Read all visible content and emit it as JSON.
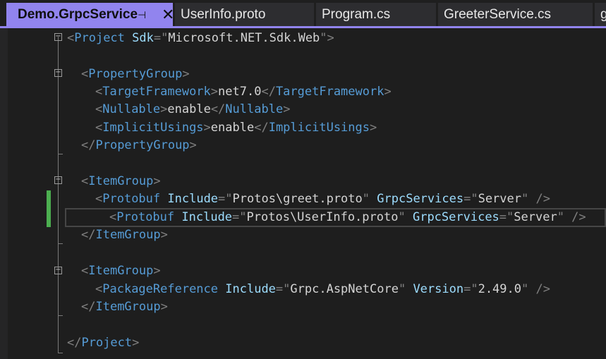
{
  "tabs": {
    "active": "Demo.GrpcService",
    "pin_glyph": "⊣",
    "close_glyph": "✕",
    "others": [
      "UserInfo.proto",
      "Program.cs",
      "GreeterService.cs",
      "g"
    ]
  },
  "code": {
    "line1": {
      "open": "<",
      "tag": "Project",
      "attr": "Sdk",
      "eq": "=\"",
      "val": "Microsoft.NET.Sdk.Web",
      "close": "\">"
    },
    "line3": {
      "open": "<",
      "tag": "PropertyGroup",
      "close": ">"
    },
    "line4": {
      "open": "<",
      "tag": "TargetFramework",
      "mid": ">",
      "text": "net7.0",
      "open2": "</",
      "tag2": "TargetFramework",
      "close": ">"
    },
    "line5": {
      "open": "<",
      "tag": "Nullable",
      "mid": ">",
      "text": "enable",
      "open2": "</",
      "tag2": "Nullable",
      "close": ">"
    },
    "line6": {
      "open": "<",
      "tag": "ImplicitUsings",
      "mid": ">",
      "text": "enable",
      "open2": "</",
      "tag2": "ImplicitUsings",
      "close": ">"
    },
    "line7": {
      "open": "</",
      "tag": "PropertyGroup",
      "close": ">"
    },
    "line9": {
      "open": "<",
      "tag": "ItemGroup",
      "close": ">"
    },
    "line10": {
      "open": "<",
      "tag": "Protobuf",
      "attr": "Include",
      "eq": "=\"",
      "val": "Protos\\greet.proto",
      "q": "\"",
      "attr2": "GrpcServices",
      "eq2": "=\"",
      "val2": "Server",
      "close": "\" />"
    },
    "line11": {
      "open": "<",
      "tag": "Protobuf",
      "attr": "Include",
      "eq": "=\"",
      "val": "Protos\\UserInfo.proto",
      "q": "\"",
      "attr2": "GrpcServices",
      "eq2": "=\"",
      "val2": "Server",
      "close": "\" />"
    },
    "line12": {
      "open": "</",
      "tag": "ItemGroup",
      "close": ">"
    },
    "line14": {
      "open": "<",
      "tag": "ItemGroup",
      "close": ">"
    },
    "line15": {
      "open": "<",
      "tag": "PackageReference",
      "attr": "Include",
      "eq": "=\"",
      "val": "Grpc.AspNetCore",
      "q": "\"",
      "attr2": "Version",
      "eq2": "=\"",
      "val2": "2.49.0",
      "close": "\" />"
    },
    "line16": {
      "open": "</",
      "tag": "ItemGroup",
      "close": ">"
    },
    "line18": {
      "open": "</",
      "tag": "Project",
      "close": ">"
    }
  },
  "fold_glyph": "−",
  "colors": {
    "tag": "#569cd6",
    "attr": "#9cdcfe",
    "value": "#d4d4d4",
    "delimiter": "#808080",
    "accent": "#9184ee",
    "change_bar": "#4caf50"
  }
}
